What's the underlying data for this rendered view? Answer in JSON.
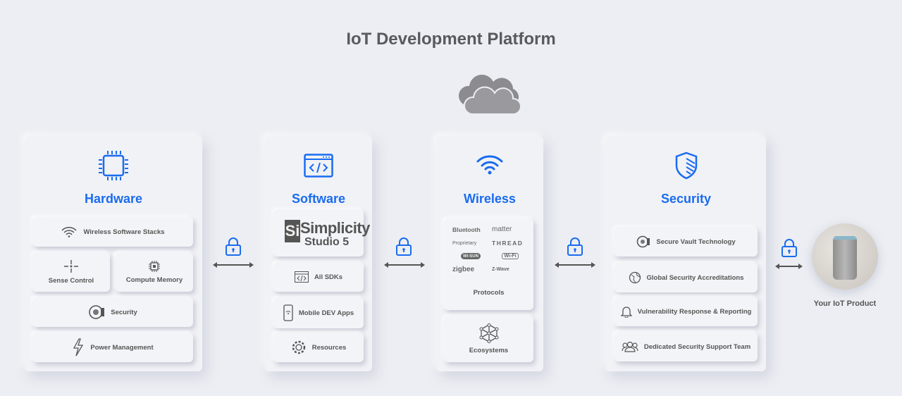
{
  "title": "IoT Development Platform",
  "accent": "#1a6cf0",
  "hardware": {
    "title": "Hardware",
    "items": [
      "Wireless Software Stacks",
      "Sense Control",
      "Compute Memory",
      "Security",
      "Power Management"
    ]
  },
  "software": {
    "title": "Software",
    "studio_logo": "Simplicity Studio 5",
    "studio_line1": "Simplicity",
    "studio_line2": "Studio 5",
    "items": [
      "All SDKs",
      "Mobile DEV Apps",
      "Resources"
    ]
  },
  "wireless": {
    "title": "Wireless",
    "protocols": [
      "Bluetooth",
      "matter",
      "Proprietary",
      "THREAD",
      "Wi-SUN",
      "Wi-Fi",
      "zigbee",
      "Z-Wave"
    ],
    "protocols_label": "Protocols",
    "ecosystems": "Ecosystems"
  },
  "security": {
    "title": "Security",
    "items": [
      "Secure Vault Technology",
      "Global Security Accreditations",
      "Vulnerability Response & Reporting",
      "Dedicated Security Support Team"
    ]
  },
  "product": {
    "label": "Your IoT Product"
  }
}
